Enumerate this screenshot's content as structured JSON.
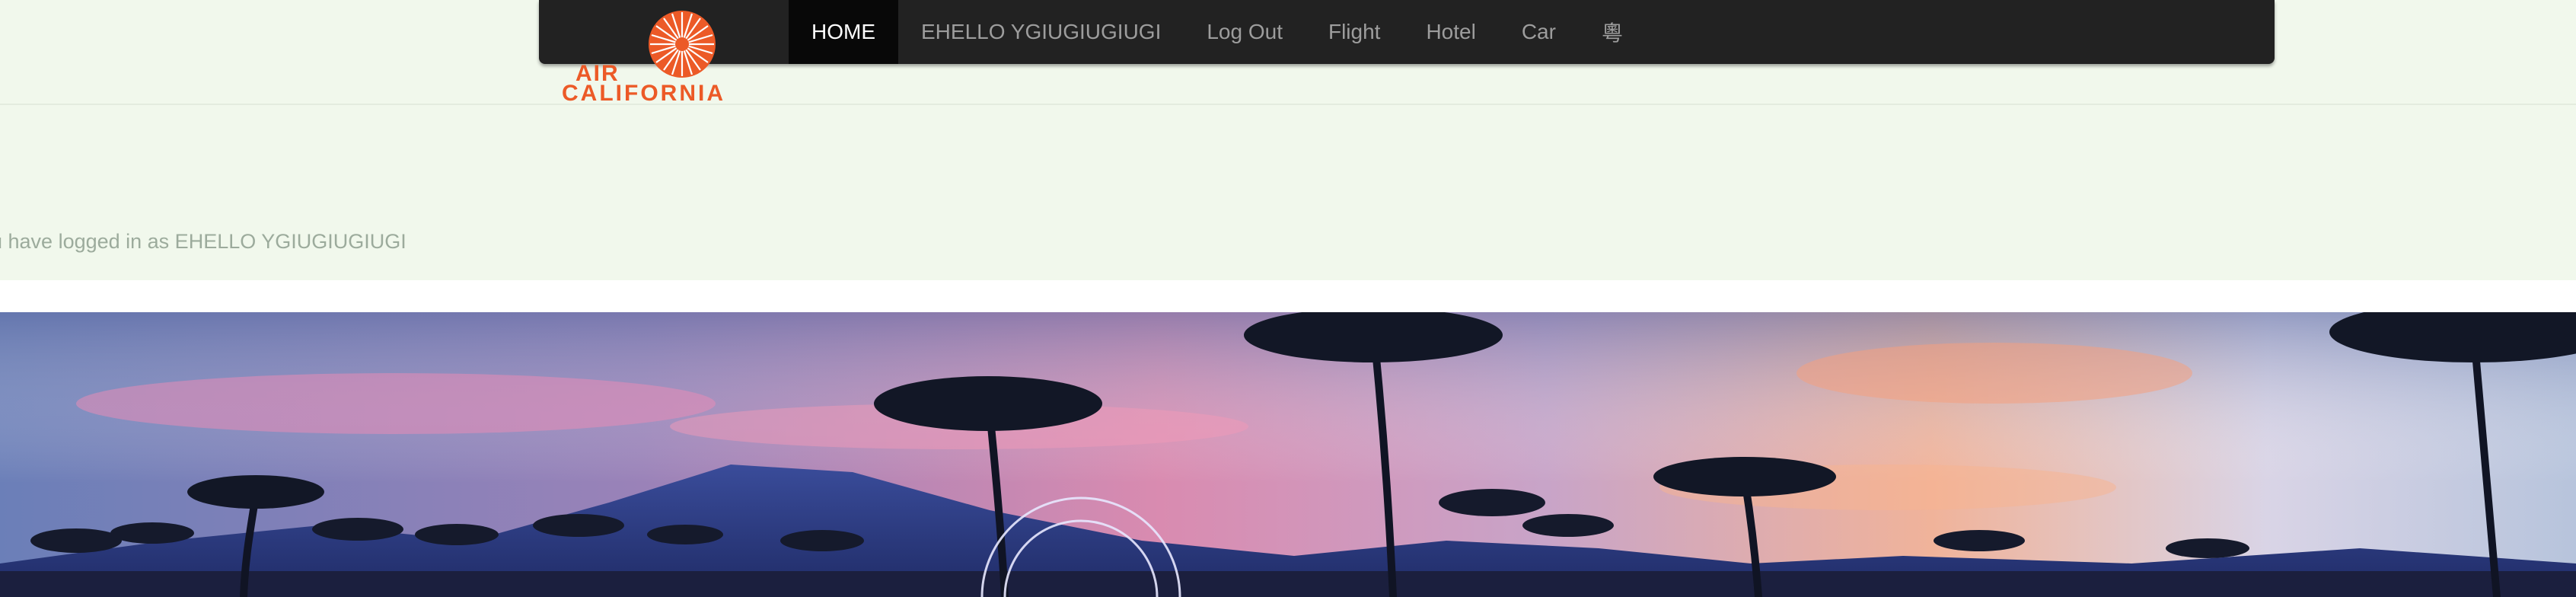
{
  "brand": {
    "line1": "AIR",
    "line2": "CALIFORNIA",
    "logo_icon": "sunburst-logo-icon",
    "accent_color": "#ec5a27"
  },
  "nav": {
    "items": [
      {
        "label": "HOME",
        "active": true
      },
      {
        "label": "EHELLO YGIUGIUGIUGI",
        "active": false
      },
      {
        "label": "Log Out",
        "active": false
      },
      {
        "label": "Flight",
        "active": false
      },
      {
        "label": "Hotel",
        "active": false
      },
      {
        "label": "Car",
        "active": false
      },
      {
        "label": "粵",
        "active": false
      }
    ]
  },
  "notice": {
    "text": "u have logged in as EHELLO YGIUGIUGIUGI"
  },
  "hero": {
    "description_icon": "sunset-palm-trees-banner"
  }
}
